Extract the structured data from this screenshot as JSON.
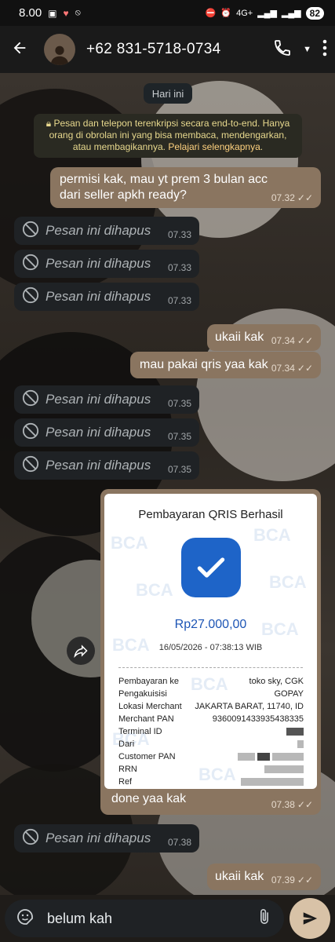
{
  "status": {
    "time": "8.00",
    "network": "4G+",
    "battery": "82"
  },
  "header": {
    "contact": "+62 831-5718-0734"
  },
  "chat": {
    "date": "Hari ini",
    "notice_text": "Pesan dan telepon terenkripsi secara end-to-end. Hanya orang di obrolan ini yang bisa membaca, mendengarkan, atau membagikannya.",
    "notice_link": "Pelajari selengkapnya",
    "deleted_label": "Pesan ini dihapus",
    "messages": [
      {
        "text": "permisi kak, mau yt prem 3 bulan acc dari seller apkh ready?",
        "time": "07.32"
      },
      {
        "time": "07.33"
      },
      {
        "time": "07.33"
      },
      {
        "time": "07.33"
      },
      {
        "text": "ukaii kak",
        "time": "07.34"
      },
      {
        "text": "mau pakai qris yaa kak",
        "time": "07.34"
      },
      {
        "time": "07.35"
      },
      {
        "time": "07.35"
      },
      {
        "time": "07.35"
      },
      {
        "text": "done yaa kak",
        "time": "07.38"
      },
      {
        "time": "07.38"
      },
      {
        "text": "ukaii kak",
        "time": "07.39"
      }
    ]
  },
  "receipt": {
    "title": "Pembayaran QRIS Berhasil",
    "amount": "Rp27.000,00",
    "datetime": "16/05/2026 - 07:38:13 WIB",
    "watermark": "BCA",
    "rows": [
      {
        "label": "Pembayaran ke",
        "value": "toko sky, CGK"
      },
      {
        "label": "Pengakuisisi",
        "value": "GOPAY"
      },
      {
        "label": "Lokasi Merchant",
        "value": "JAKARTA BARAT, 11740, ID"
      },
      {
        "label": "Merchant PAN",
        "value": "9360091433935438335"
      },
      {
        "label": "Terminal ID",
        "value": ""
      },
      {
        "label": "Dari",
        "value": ""
      },
      {
        "label": "Customer PAN",
        "value": ""
      },
      {
        "label": "RRN",
        "value": ""
      },
      {
        "label": "Ref",
        "value": ""
      }
    ]
  },
  "composer": {
    "text": "belum kah"
  }
}
